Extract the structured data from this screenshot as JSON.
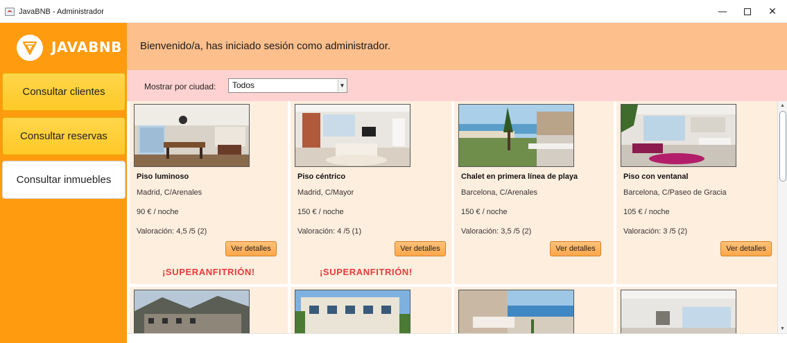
{
  "window": {
    "title": "JavaBNB - Administrador",
    "minimize_glyph": "—",
    "close_glyph": "✕"
  },
  "sidebar": {
    "logo_text": "JAVABNB",
    "items": [
      {
        "label": "Consultar clientes"
      },
      {
        "label": "Consultar reservas"
      },
      {
        "label": "Consultar inmuebles"
      }
    ]
  },
  "header": {
    "welcome": "Bienvenido/a, has iniciado sesión como administrador."
  },
  "filter": {
    "label": "Mostrar por ciudad:",
    "selected": "Todos"
  },
  "cards": [
    {
      "title": "Piso luminoso",
      "address": "Madrid, C/Arenales",
      "price": "90 € / noche",
      "rating": "Valoración: 4,5 /5 (2)",
      "button": "Ver detalles",
      "badge": "¡SUPERANFITRIÓN!"
    },
    {
      "title": "Piso céntrico",
      "address": "Madrid, C/Mayor",
      "price": "150 € / noche",
      "rating": "Valoración: 4 /5 (1)",
      "button": "Ver detalles",
      "badge": "¡SUPERANFITRIÓN!"
    },
    {
      "title": "Chalet en primera línea de playa",
      "address": "Barcelona, C/Arenales",
      "price": "150 € / noche",
      "rating": "Valoración: 3,5 /5 (2)",
      "button": "Ver detalles",
      "badge": ""
    },
    {
      "title": "Piso con ventanal",
      "address": "Barcelona, C/Paseo de Gracia",
      "price": "105 € / noche",
      "rating": "Valoración: 3 /5 (2)",
      "button": "Ver detalles",
      "badge": ""
    }
  ],
  "colors": {
    "sidebar": "#ff9b0f",
    "header": "#fdbf8c",
    "filter_bar": "#ffd2d2",
    "card": "#feeede",
    "superhost": "#e83a3a"
  }
}
